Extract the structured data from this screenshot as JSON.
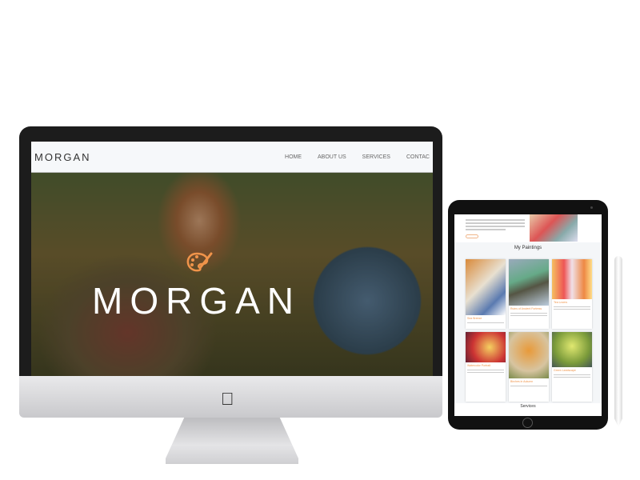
{
  "desktop": {
    "nav": {
      "logo": "MORGAN",
      "items": [
        "HOME",
        "ABOUT US",
        "SERVICES",
        "CONTAC"
      ]
    },
    "hero": {
      "title": "MORGAN",
      "icon": "palette-icon",
      "accent": "#f0944a"
    }
  },
  "tablet": {
    "paintings_heading": "My Paintings",
    "paintings": [
      {
        "title": "Sea Breeze"
      },
      {
        "title": "Ruins of Ancient Fortress"
      },
      {
        "title": "Tea Lovers"
      },
      {
        "title": "Watercolor Portrait"
      },
      {
        "title": "Birches in Autumn"
      },
      {
        "title": "Green Landscape"
      }
    ],
    "services_heading": "Services"
  }
}
